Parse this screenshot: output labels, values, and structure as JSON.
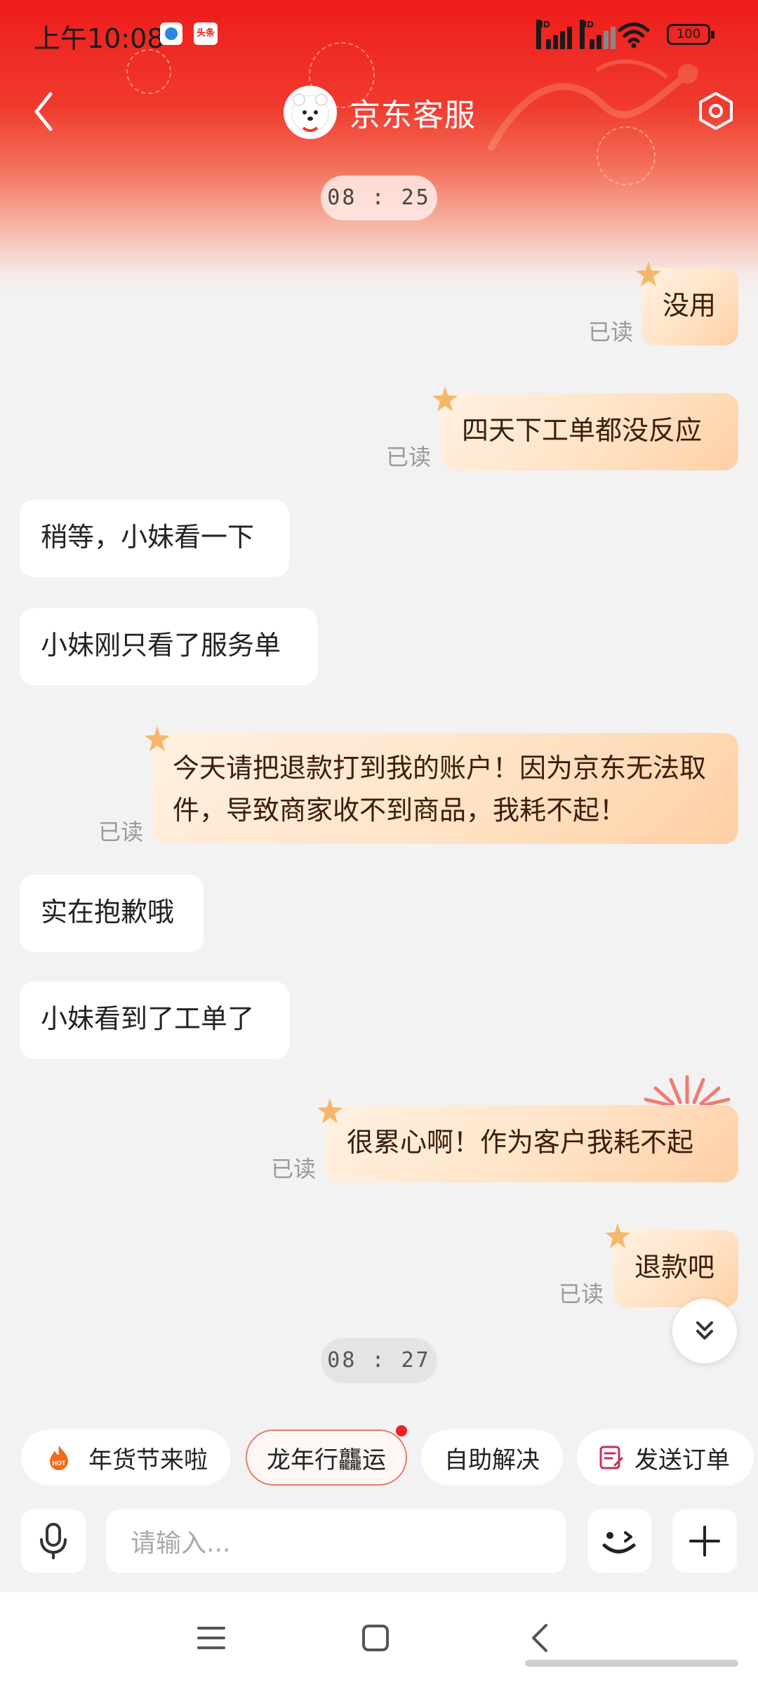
{
  "status_bar": {
    "time": "上午10:08",
    "notif_badge": "头条",
    "sim1_label": "HD",
    "sim2_label": "HD",
    "battery": "100"
  },
  "header": {
    "title": "京东客服",
    "back_icon": "chevron-left-icon",
    "settings_icon": "settings-hexagon-icon"
  },
  "timestamps": [
    "08 : 25",
    "08 : 27"
  ],
  "read_label": "已读",
  "messages": [
    {
      "side": "out",
      "text": "没用"
    },
    {
      "side": "out",
      "text": "四天下工单都没反应"
    },
    {
      "side": "in",
      "text": "稍等，小妹看一下"
    },
    {
      "side": "in",
      "text": "小妹刚只看了服务单"
    },
    {
      "side": "out",
      "text": "今天请把退款打到我的账户！因为京东无法取件，导致商家收不到商品，我耗不起！"
    },
    {
      "side": "in",
      "text": "实在抱歉哦"
    },
    {
      "side": "in",
      "text": "小妹看到了工单了"
    },
    {
      "side": "out",
      "text": "很累心啊！作为客户我耗不起"
    },
    {
      "side": "out",
      "text": "退款吧"
    }
  ],
  "quick_actions": [
    {
      "label": "年货节来啦",
      "icon": "hot-flame-icon"
    },
    {
      "label": "龙年行龘运",
      "icon": ""
    },
    {
      "label": "自助解决",
      "icon": ""
    },
    {
      "label": "发送订单",
      "icon": "order-icon"
    }
  ],
  "input": {
    "placeholder": "请输入..."
  },
  "colors": {
    "header_red": "#ee1c1c",
    "outgoing_bubble": "#ffe3c6",
    "incoming_bubble": "#ffffff",
    "chip_highlight_border": "#e77a6a"
  }
}
